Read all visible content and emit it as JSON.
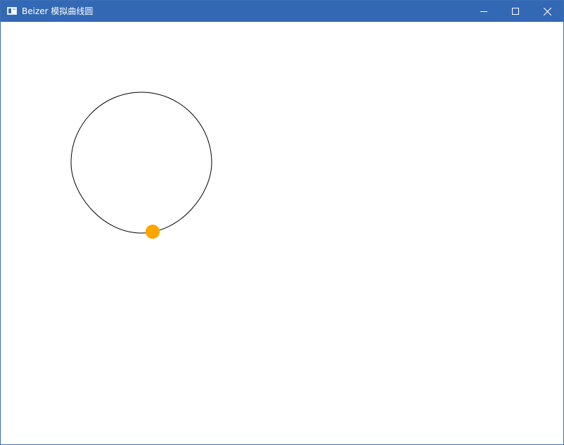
{
  "window": {
    "title": "Beizer 模拟曲线圆",
    "titlebar_color": "#3368b5"
  },
  "icons": {
    "app": "app-window-icon",
    "minimize": "minimize-icon",
    "maximize": "maximize-icon",
    "close": "close-icon"
  },
  "canvas": {
    "background": "#ffffff",
    "curve_color": "#000000",
    "marker_color": "#ffa500"
  }
}
